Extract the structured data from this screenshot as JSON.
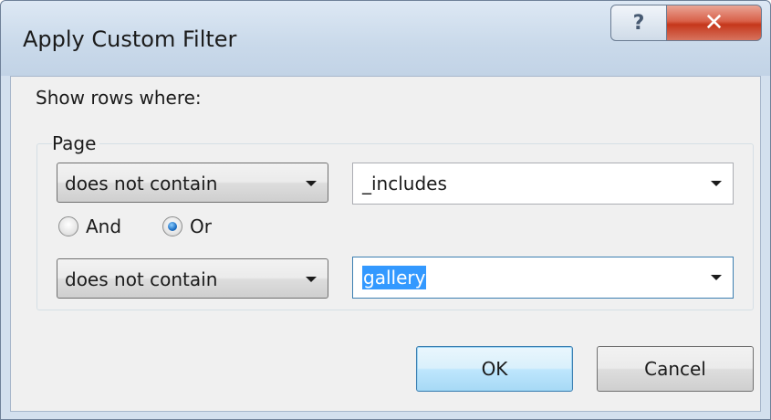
{
  "window": {
    "title": "Apply Custom Filter",
    "help_glyph": "?",
    "close_glyph": "✕"
  },
  "dialog": {
    "show_rows_label": "Show rows where:",
    "group_label": "Page",
    "condition1": {
      "operator": "does not contain",
      "value": "_includes"
    },
    "logic": {
      "and_label": "And",
      "or_label": "Or",
      "selected": "Or"
    },
    "condition2": {
      "operator": "does not contain",
      "value": "gallery"
    },
    "ok_label": "OK",
    "cancel_label": "Cancel"
  }
}
